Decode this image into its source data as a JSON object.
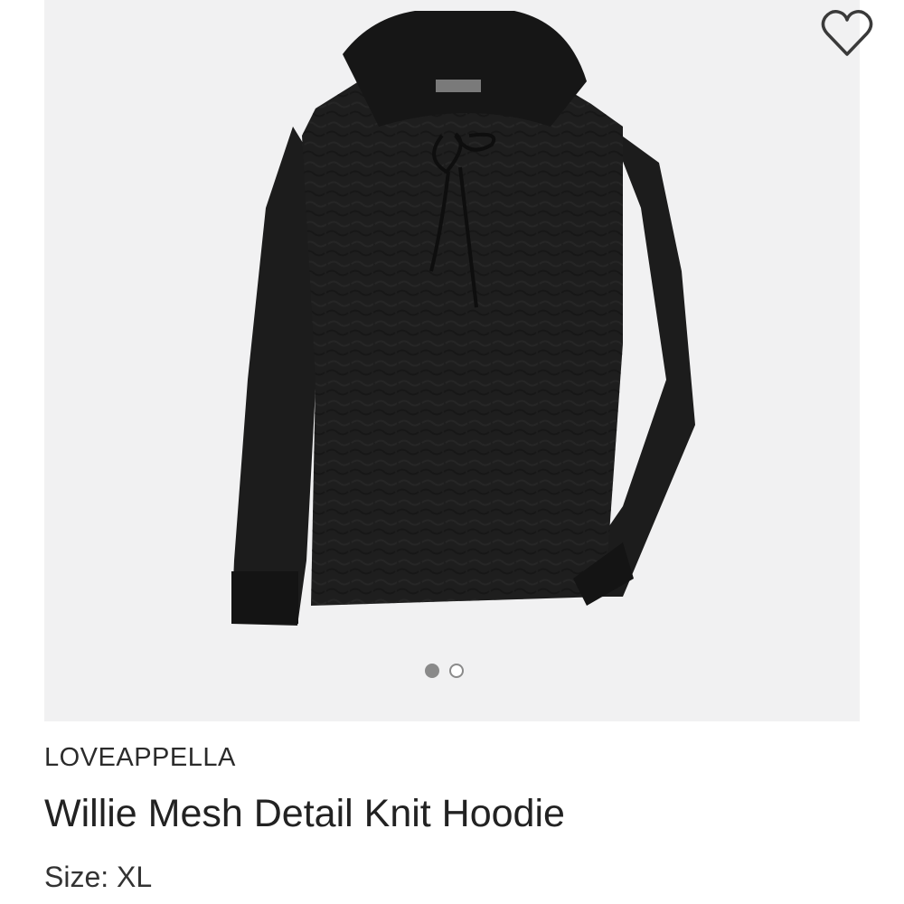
{
  "product": {
    "brand": "LOVEAPPELLA",
    "title": "Willie Mesh Detail Knit Hoodie",
    "size_text": "Size: XL"
  },
  "image": {
    "subject": "black textured knit hoodie",
    "carousel_count": 2,
    "carousel_active_index": 0
  },
  "icons": {
    "favorite": "heart-outline-icon"
  },
  "colors": {
    "panel_bg": "#f1f1f2",
    "garment": "#1c1c1c",
    "dot": "#8a8a8a",
    "text": "#2b2b2b"
  }
}
